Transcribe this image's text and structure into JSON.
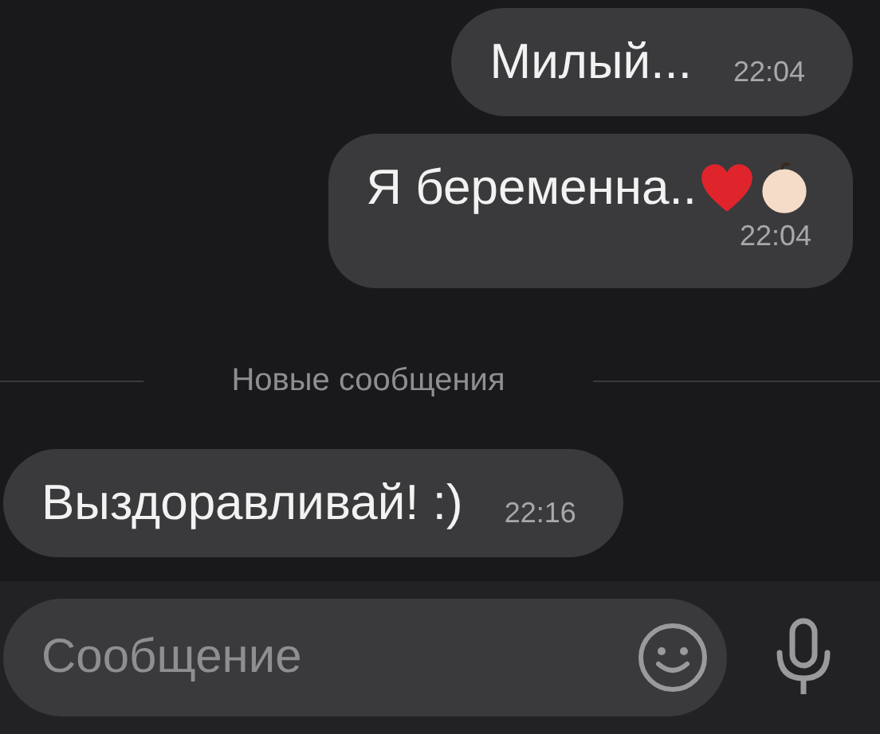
{
  "messages": [
    {
      "kind": "outgoing",
      "text": "Милый...",
      "time": "22:04",
      "time_below": false
    },
    {
      "kind": "outgoing",
      "text": "Я беременна..",
      "emoji": [
        {
          "kind": "heart"
        },
        {
          "kind": "baby"
        }
      ],
      "time": "22:04",
      "time_below": true
    },
    {
      "kind": "divider",
      "text": "Новые сообщения"
    },
    {
      "kind": "incoming",
      "text": "Выздоравливай! :)",
      "time": "22:16",
      "time_below": false
    }
  ],
  "composer": {
    "placeholder": "Сообщение"
  }
}
